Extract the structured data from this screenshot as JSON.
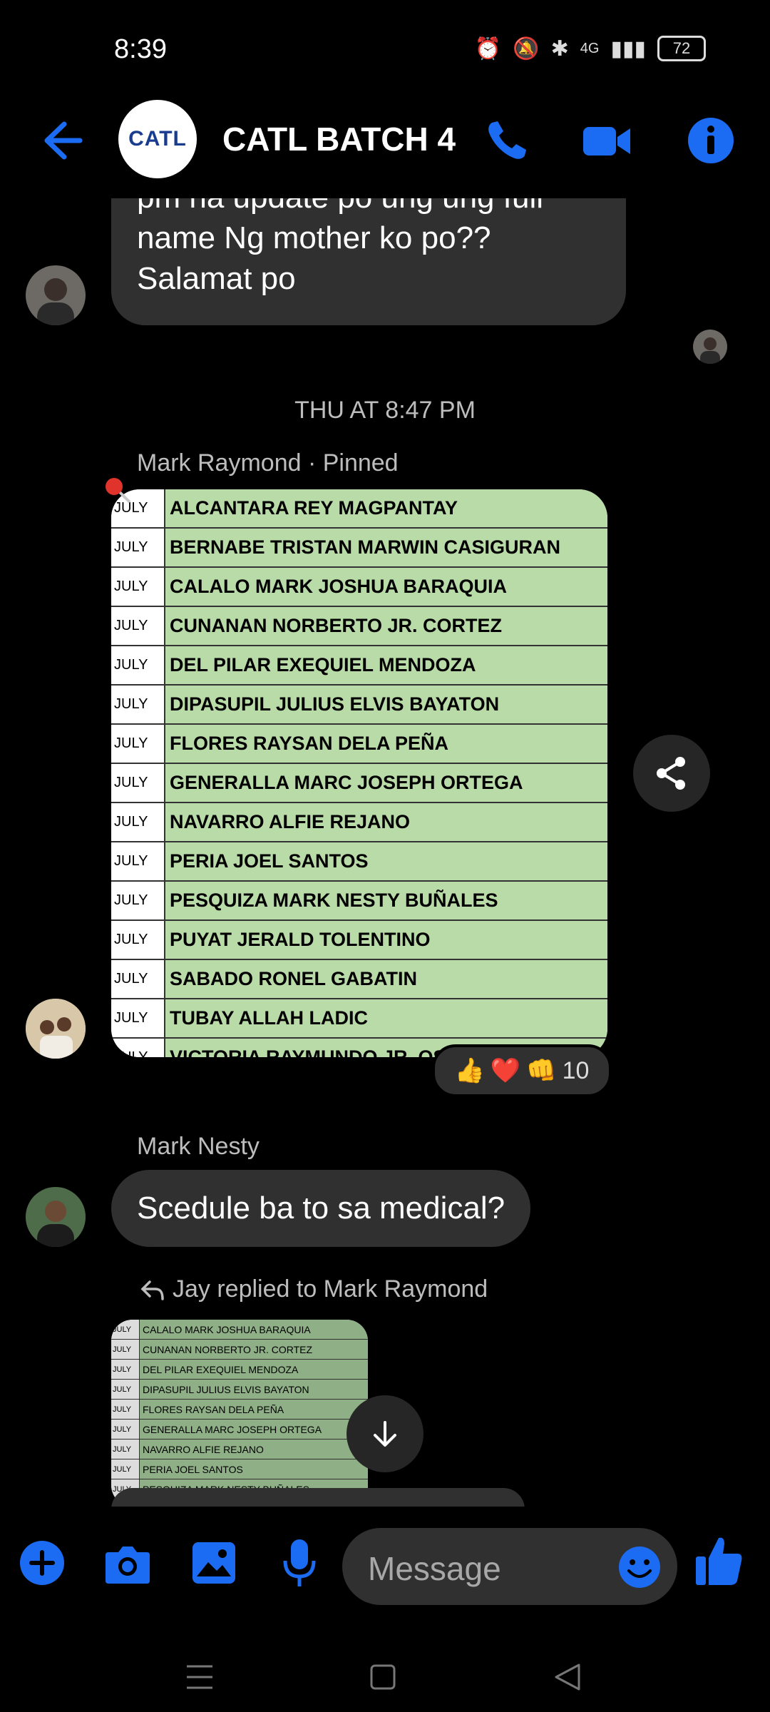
{
  "status": {
    "time": "8:39",
    "network": "4G",
    "battery": "72"
  },
  "header": {
    "logo_text": "CATL",
    "title": "CATL BATCH 4"
  },
  "messages": {
    "first_bubble": [
      "pm na update po ung ung full",
      "name Ng mother ko po??",
      "Salamat po"
    ],
    "timestamp": "THU AT 8:47 PM",
    "pinned_sender": "Mark Raymond · Pinned",
    "reactions_count": "10",
    "second_sender": "Mark Nesty",
    "second_text": "Scedule ba to sa medical?",
    "reply_label": "Jay replied to Mark Raymond"
  },
  "list_image": {
    "month": "JULY",
    "names": [
      "ALCANTARA REY MAGPANTAY",
      "BERNABE TRISTAN MARWIN CASIGURAN",
      "CALALO MARK JOSHUA BARAQUIA",
      "CUNANAN NORBERTO JR. CORTEZ",
      "DEL PILAR EXEQUIEL MENDOZA",
      "DIPASUPIL JULIUS ELVIS BAYATON",
      "FLORES RAYSAN DELA PEÑA",
      "GENERALLA MARC JOSEPH ORTEGA",
      "NAVARRO ALFIE REJANO",
      "PERIA JOEL SANTOS",
      "PESQUIZA MARK NESTY BUÑALES",
      "PUYAT JERALD TOLENTINO",
      "SABADO RONEL GABATIN",
      "TUBAY ALLAH LADIC",
      "VICTORIA RAYMUNDO JR. OSILA"
    ]
  },
  "reply_image": {
    "month": "JULY",
    "names": [
      "CALALO MARK JOSHUA BARAQUIA",
      "CUNANAN NORBERTO JR. CORTEZ",
      "DEL PILAR EXEQUIEL MENDOZA",
      "DIPASUPIL JULIUS ELVIS BAYATON",
      "FLORES RAYSAN DELA PEÑA",
      "GENERALLA MARC JOSEPH ORTEGA",
      "NAVARRO ALFIE REJANO",
      "PERIA JOEL SANTOS",
      "PESQUIZA MARK NESTY BUÑALES"
    ]
  },
  "composer": {
    "placeholder": "Message"
  },
  "colors": {
    "accent": "#1b6cf2",
    "bubble": "#303030",
    "list_green": "#b9dba8"
  }
}
